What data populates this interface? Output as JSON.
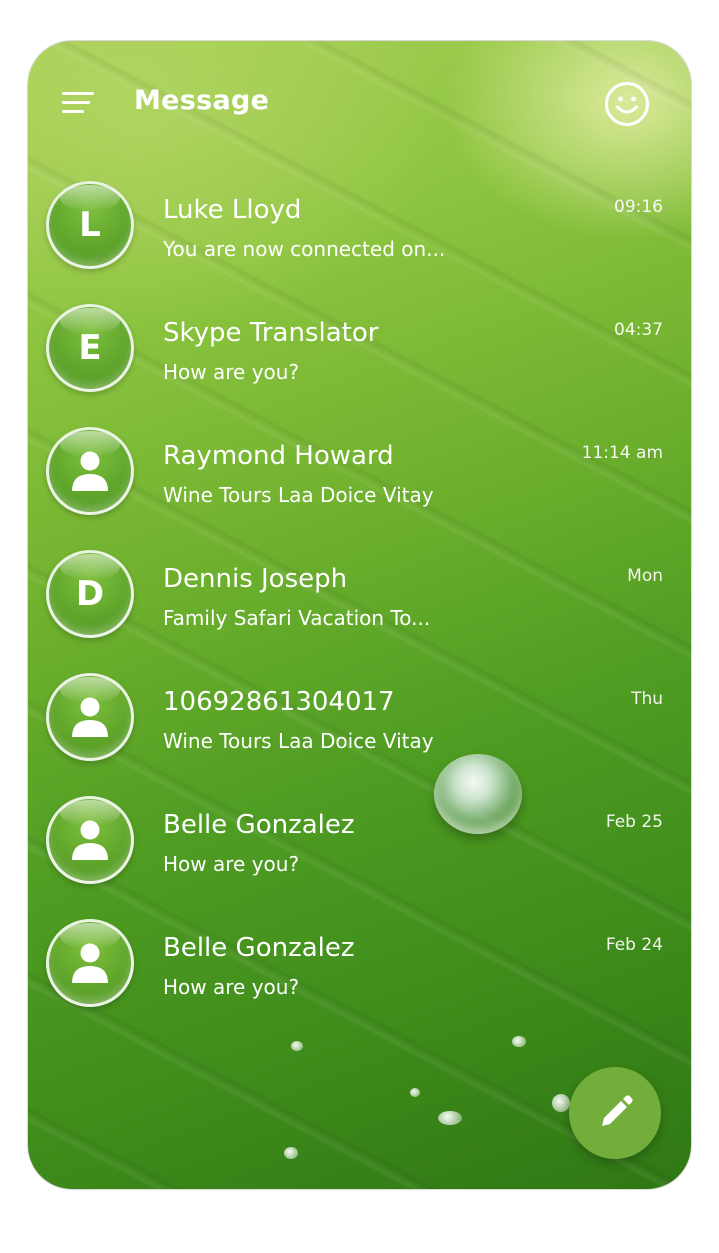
{
  "header": {
    "title": "Message",
    "menu_icon": "menu-icon",
    "right_icon": "smiley-icon"
  },
  "conversations": [
    {
      "avatar_type": "letter",
      "avatar_letter": "L",
      "name": "Luke Lloyd",
      "preview": "You are now connected on...",
      "time": "09:16"
    },
    {
      "avatar_type": "letter",
      "avatar_letter": "E",
      "name": "Skype Translator",
      "preview": "How are you?",
      "time": "04:37"
    },
    {
      "avatar_type": "person",
      "avatar_letter": "",
      "name": "Raymond Howard",
      "preview": "Wine Tours Laa Doice Vitay",
      "time": "11:14 am"
    },
    {
      "avatar_type": "letter",
      "avatar_letter": "D",
      "name": "Dennis Joseph",
      "preview": "Family Safari Vacation To...",
      "time": "Mon"
    },
    {
      "avatar_type": "person",
      "avatar_letter": "",
      "name": "10692861304017",
      "preview": "Wine Tours Laa Doice Vitay",
      "time": "Thu"
    },
    {
      "avatar_type": "person",
      "avatar_letter": "",
      "name": "Belle Gonzalez",
      "preview": "How are you?",
      "time": "Feb 25"
    },
    {
      "avatar_type": "person",
      "avatar_letter": "",
      "name": "Belle Gonzalez",
      "preview": "How are you?",
      "time": "Feb 24"
    }
  ],
  "fab": {
    "icon": "pencil-icon"
  },
  "colors": {
    "accent": "#73ad3c",
    "avatar": "#5fa52b",
    "text": "#ffffff"
  }
}
